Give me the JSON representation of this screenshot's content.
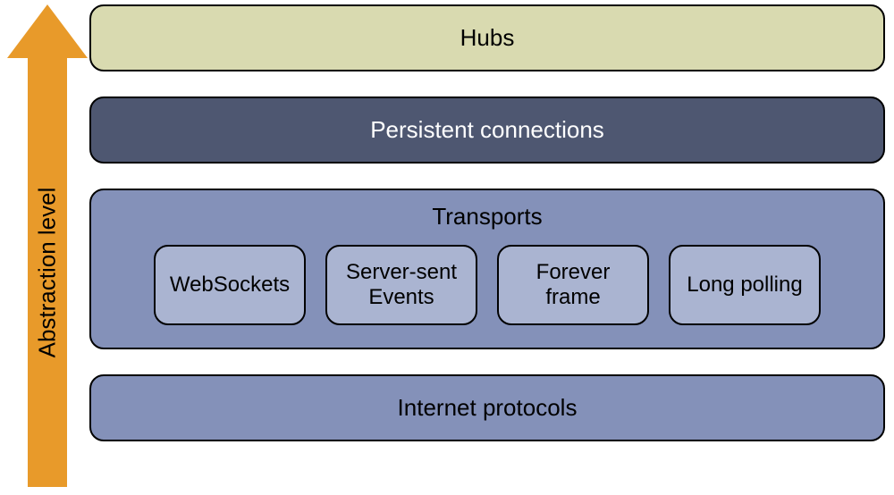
{
  "arrow": {
    "label": "Abstraction level"
  },
  "layers": {
    "hubs": {
      "label": "Hubs"
    },
    "persistent": {
      "label": "Persistent connections"
    },
    "transports": {
      "title": "Transports",
      "items": [
        {
          "label": "WebSockets"
        },
        {
          "label": "Server-sent Events"
        },
        {
          "label": "Forever frame"
        },
        {
          "label": "Long polling"
        }
      ]
    },
    "internet": {
      "label": "Internet protocols"
    }
  },
  "colors": {
    "arrow": "#e89a2a",
    "hubs_bg": "#d9dab0",
    "persistent_bg": "#4e5771",
    "transports_bg": "#8491b9",
    "transport_item_bg": "#aab4d1",
    "internet_bg": "#8491b9"
  }
}
